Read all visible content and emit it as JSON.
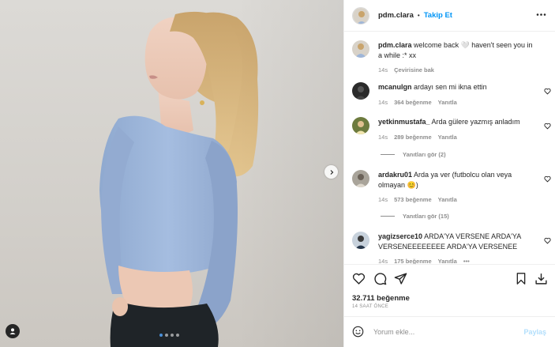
{
  "post": {
    "username": "pdm.clara",
    "separator": "•",
    "follow_label": "Takip Et",
    "carousel": {
      "slide_count": 4,
      "active_index": 0
    }
  },
  "icons": {
    "more": "more-horizontal-icon",
    "next": "chevron-right-icon",
    "tag": "user-tag-icon",
    "like": "heart-icon",
    "comment": "comment-icon",
    "share": "send-icon",
    "save": "bookmark-icon",
    "save_collection": "save-to-collection-icon",
    "emoji": "emoji-icon"
  },
  "caption": {
    "username": "pdm.clara",
    "text": "welcome back 🤍 haven't seen you in a while :* xx",
    "time": "14s",
    "translate": "Çevirisine bak"
  },
  "comments": [
    {
      "username": "mcanulgn",
      "text": "ardayı sen mi ikna ettin",
      "time": "14s",
      "likes": "364 beğenme",
      "reply": "Yanıtla"
    },
    {
      "username": "yetkinmustafa_",
      "text": "Arda gülere yazmış anladım",
      "time": "14s",
      "likes": "289 beğenme",
      "reply": "Yanıtla",
      "view_replies": "Yanıtları gör (2)"
    },
    {
      "username": "ardakru01",
      "text": "Arda ya ver (futbolcu olan veya olmayan 😊)",
      "time": "14s",
      "likes": "573 beğenme",
      "reply": "Yanıtla",
      "view_replies": "Yanıtları gör (15)"
    },
    {
      "username": "yagizserce10",
      "text": "ARDA'YA VERSENE ARDA'YA VERSENEEEEEEEE ARDA'YA VERSENEE",
      "time": "14s",
      "likes": "175 beğenme",
      "reply": "Yanıtla",
      "more": "•••"
    }
  ],
  "stats": {
    "likes": "32.711 beğenme",
    "posted": "14 SAAT ÖNCE"
  },
  "composer": {
    "placeholder": "Yorum ekle...",
    "value": "",
    "post_label": "Paylaş"
  },
  "colors": {
    "accent": "#0095f6",
    "post_disabled": "#b2dffc",
    "secondary_text": "#8e8e8e",
    "divider": "#efefef",
    "carousel_active_dot": "#4a90d9"
  }
}
